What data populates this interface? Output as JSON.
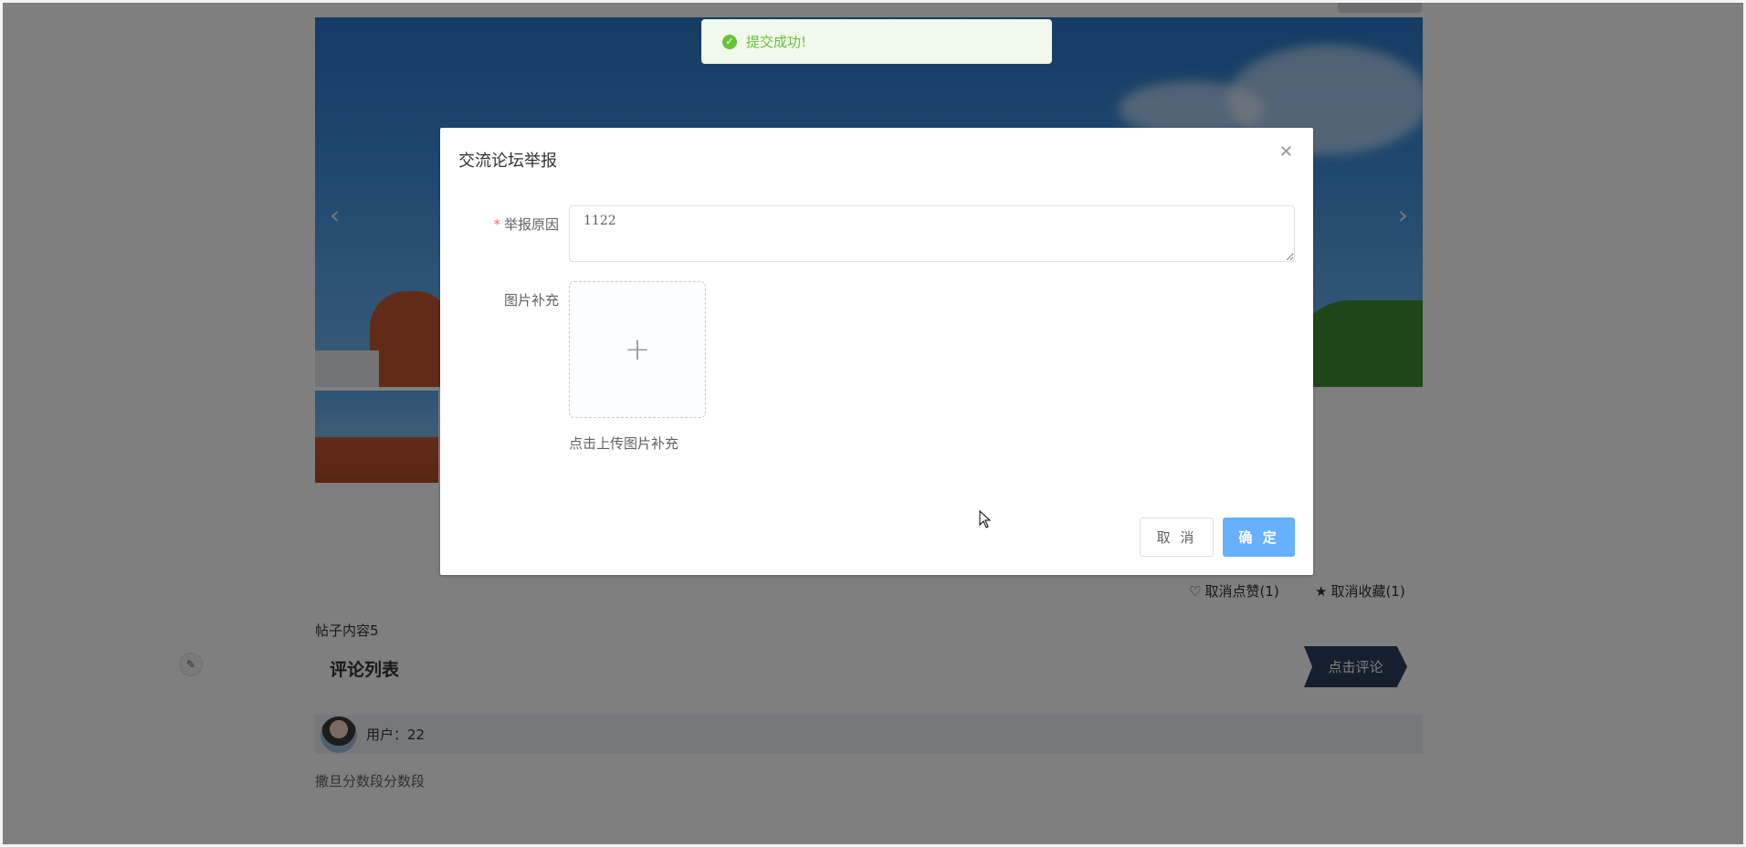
{
  "page": {
    "post_content": "帖子内容5",
    "actions": {
      "like_label": "取消点赞(1)",
      "favorite_label": "取消收藏(1)"
    },
    "comments": {
      "title": "评论列表",
      "add_button": "点击评论",
      "items": [
        {
          "user": "用户：22",
          "text": "撒旦分数段分数段"
        }
      ]
    }
  },
  "dialog": {
    "title": "交流论坛举报",
    "reason": {
      "required_mark": "*",
      "label": "举报原因",
      "value": "1122"
    },
    "image": {
      "label": "图片补充",
      "tip": "点击上传图片补充"
    },
    "cancel_label": "取 消",
    "confirm_label": "确 定"
  },
  "toast": {
    "message": "提交成功!"
  },
  "colors": {
    "primary": "#66b1ff",
    "success": "#67c23a",
    "success_bg": "#f0f9eb",
    "danger": "#f56c6c",
    "comment_button_bg": "#2c3e5b"
  }
}
